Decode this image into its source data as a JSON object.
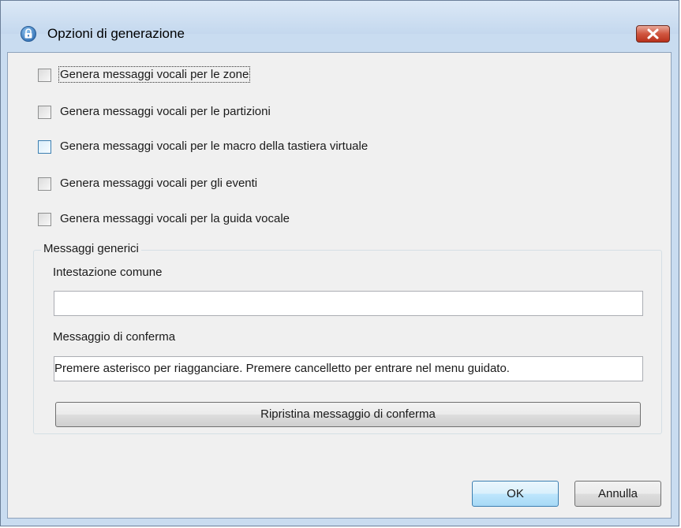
{
  "window": {
    "title": "Opzioni di generazione",
    "icon": "lock-icon",
    "close_icon": "close-icon",
    "accent_color": "#3c7fb1"
  },
  "checkboxes": [
    {
      "label": "Genera messaggi vocali per le zone",
      "checked": false
    },
    {
      "label": "Genera messaggi vocali per le partizioni",
      "checked": false
    },
    {
      "label": "Genera messaggi vocali per le macro della tastiera virtuale",
      "checked": false
    },
    {
      "label": "Genera messaggi vocali per gli eventi",
      "checked": false
    },
    {
      "label": "Genera messaggi vocali per la guida vocale",
      "checked": false
    }
  ],
  "group": {
    "title": "Messaggi generici",
    "header_label": "Intestazione comune",
    "header_value": "",
    "confirm_label": "Messaggio di conferma",
    "confirm_value": "Premere asterisco per riagganciare. Premere cancelletto per entrare nel menu guidato.",
    "reset_button": "Ripristina messaggio di conferma"
  },
  "buttons": {
    "ok": "OK",
    "cancel": "Annulla"
  }
}
